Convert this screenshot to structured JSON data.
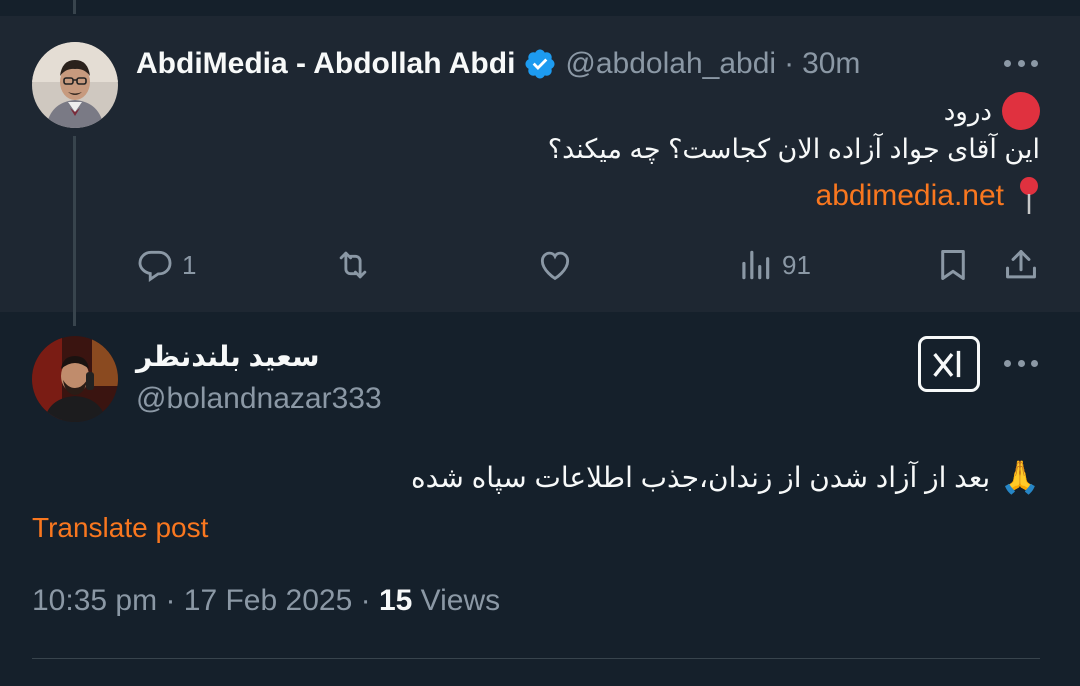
{
  "quoted_post": {
    "author_name": "AbdiMedia - Abdollah Abdi",
    "handle": "@abdolah_abdi",
    "separator": "·",
    "time": "30m",
    "line1": "درود",
    "line2": "این آقای جواد آزاده الان کجاست؟ چه میکند؟",
    "link": "abdimedia.net",
    "actions": {
      "reply_count": "1",
      "views_count": "91"
    },
    "verified_color": "#1d9bf0"
  },
  "main_post": {
    "author_name": "سعید بلندنظر",
    "handle": "@bolandnazar333",
    "text": "بعد از آزاد شدن از زندان،جذب اطلاعات سپاه شده",
    "emoji": "🙏",
    "translate_label": "Translate post",
    "timestamp": "10:35 pm",
    "separator": "·",
    "date": "17 Feb 2025",
    "views_count": "15",
    "views_label": "Views"
  },
  "icons": [
    "verified-badge-icon",
    "more-icon",
    "red-circle-icon",
    "pin-icon",
    "reply-icon",
    "retweet-icon",
    "like-icon",
    "views-icon",
    "bookmark-icon",
    "share-icon",
    "grok-icon"
  ],
  "colors": {
    "background": "#15202b",
    "quoted_background": "#1e2732",
    "accent": "#f9771f",
    "muted": "#8b98a5"
  }
}
